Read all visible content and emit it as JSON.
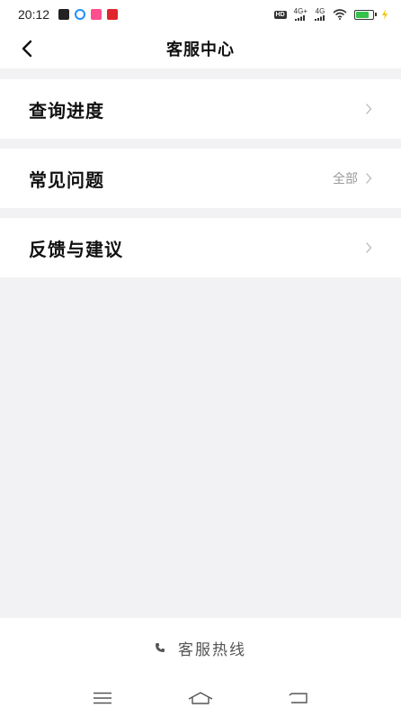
{
  "status_bar": {
    "time": "20:12",
    "hd_label": "HD",
    "network_1": "4G+",
    "network_2": "4G",
    "battery_level": 0.75,
    "colors": {
      "notif_1": "#222222",
      "notif_2": "#1f8fff",
      "notif_3": "#ff4d8d",
      "notif_4": "#e0242b",
      "battery": "#35c24a"
    }
  },
  "header": {
    "title": "客服中心",
    "back_icon": "chevron-left-icon"
  },
  "menu": {
    "items": [
      {
        "label": "查询进度",
        "extra": ""
      },
      {
        "label": "常见问题",
        "extra": "全部"
      },
      {
        "label": "反馈与建议",
        "extra": ""
      }
    ]
  },
  "footer": {
    "hotline_label": "客服热线",
    "hotline_icon": "phone-icon"
  },
  "system_nav": {
    "icons": [
      "menu-icon",
      "home-icon",
      "back-icon"
    ]
  }
}
